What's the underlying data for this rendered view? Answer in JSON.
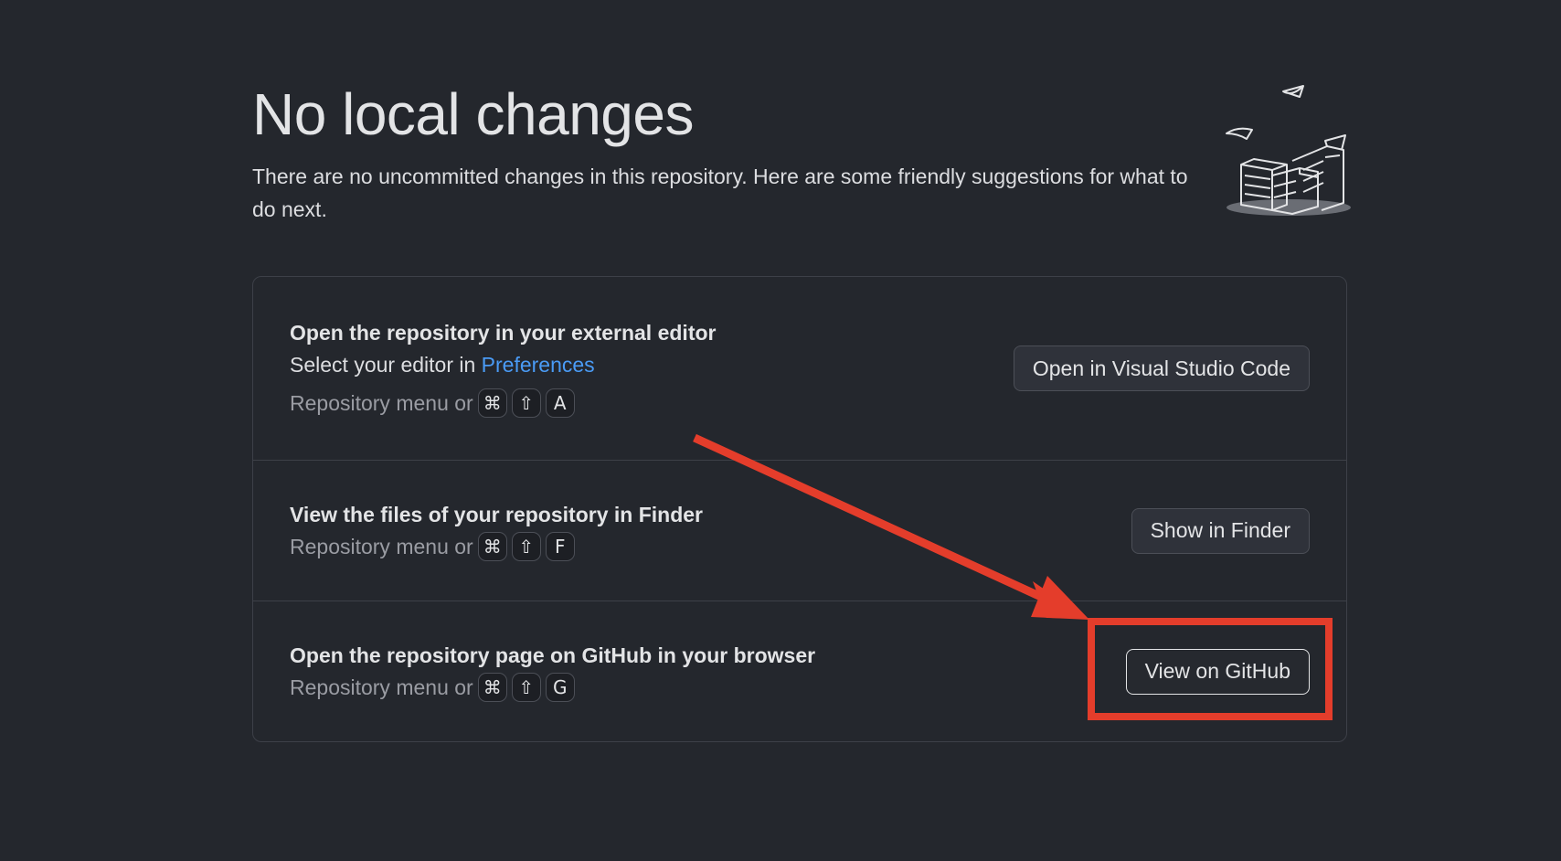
{
  "blank_slate": {
    "heading": "No local changes",
    "subtitle": "There are no uncommitted changes in this repository. Here are some friendly suggestions for what to do next."
  },
  "suggestions": [
    {
      "title": "Open the repository in your external editor",
      "line_prefix": "Select your editor in ",
      "link": "Preferences",
      "hint": "Repository menu or",
      "keys": [
        "⌘",
        "⇧",
        "A"
      ],
      "button": "Open in Visual Studio Code"
    },
    {
      "title": "View the files of your repository in Finder",
      "hint": "Repository menu or",
      "keys": [
        "⌘",
        "⇧",
        "F"
      ],
      "button": "Show in Finder"
    },
    {
      "title": "Open the repository page on GitHub in your browser",
      "hint": "Repository menu or",
      "keys": [
        "⌘",
        "⇧",
        "G"
      ],
      "button": "View on GitHub"
    }
  ],
  "annotation": {
    "color": "#e43d2b"
  },
  "colors": {
    "background": "#24272d",
    "link": "#4a9bf5"
  }
}
